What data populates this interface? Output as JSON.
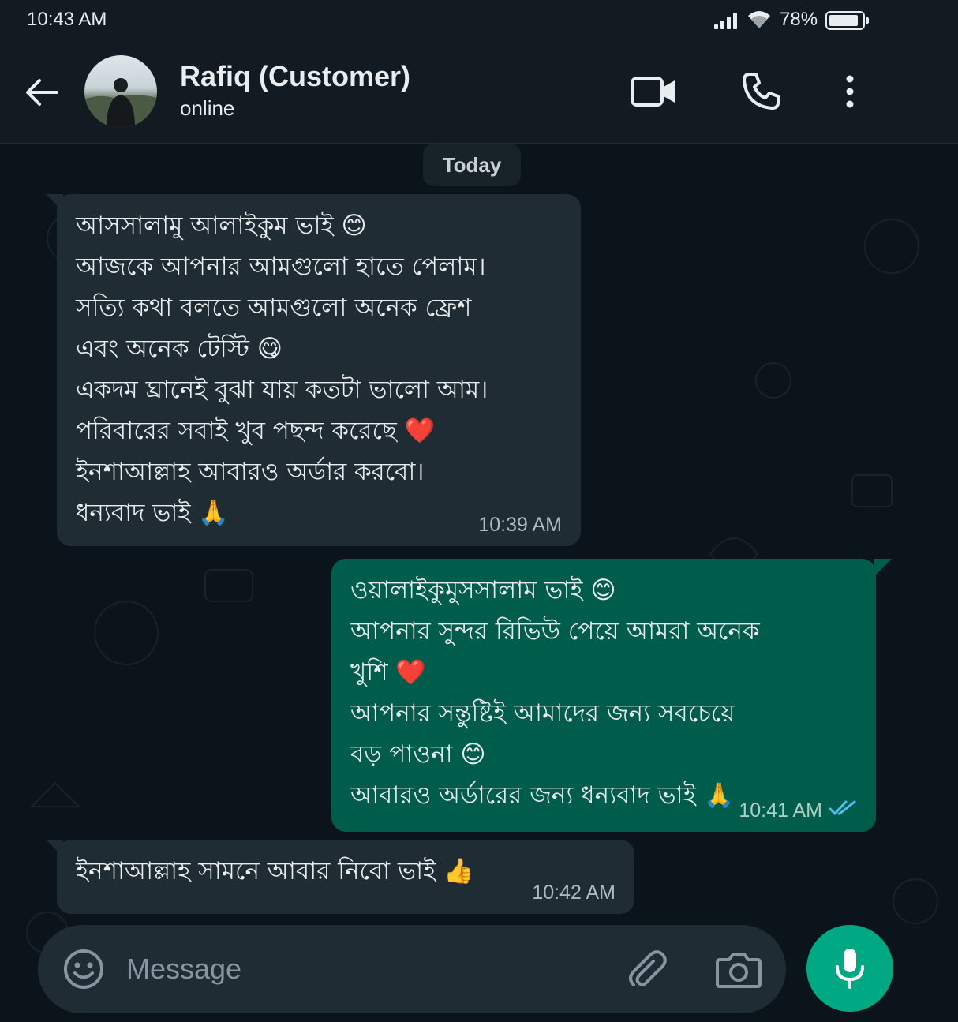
{
  "status_bar": {
    "time": "10:43 AM",
    "battery_percent": "78%",
    "battery_level": 0.78,
    "icons": [
      "signal-icon",
      "wifi-icon",
      "battery-icon"
    ]
  },
  "header": {
    "contact_name": "Rafiq (Customer)",
    "contact_status": "online",
    "icons": [
      "back-arrow-icon",
      "video-call-icon",
      "voice-call-icon",
      "more-options-icon"
    ]
  },
  "chat": {
    "date_separator": "Today",
    "messages": [
      {
        "direction": "incoming",
        "lines": [
          "আসসালামু আলাইকুম ভাই 😊",
          "আজকে আপনার আমগুলো হাতে পেলাম।",
          "সত্যি কথা বলতে আমগুলো অনেক ফ্রেশ",
          "এবং অনেক টেস্টি 😋",
          "একদম ঘ্রানেই বুঝা যায় কতটা ভালো আম।",
          "পরিবারের সবাই খুব পছন্দ করেছে ❤️",
          "ইনশাআল্লাহ আবারও অর্ডার করবো।",
          "ধন্যবাদ ভাই 🙏"
        ],
        "time": "10:39 AM"
      },
      {
        "direction": "outgoing",
        "lines": [
          "ওয়ালাইকুমুসসালাম ভাই 😊",
          "আপনার সুন্দর রিভিউ পেয়ে আমরা অনেক",
          "খুশি ❤️",
          "আপনার সন্তুষ্টিই আমাদের জন্য সবচেয়ে",
          "বড় পাওনা 😊",
          "আবারও অর্ডারের জন্য ধন্যবাদ ভাই 🙏"
        ],
        "time": "10:41 AM",
        "read_receipt": "double-check-read-icon"
      },
      {
        "direction": "incoming",
        "lines": [
          "ইনশাআল্লাহ সামনে আবার নিবো ভাই 👍"
        ],
        "time": "10:42 AM"
      }
    ]
  },
  "composer": {
    "placeholder": "Message",
    "value": "",
    "icons": [
      "emoji-icon",
      "paperclip-icon",
      "camera-icon",
      "microphone-icon"
    ]
  },
  "colors": {
    "background": "#0b141a",
    "header": "#111b21",
    "incoming_bubble": "#202c33",
    "outgoing_bubble": "#005c4b",
    "accent": "#00a884",
    "read_tick": "#53bdeb"
  }
}
